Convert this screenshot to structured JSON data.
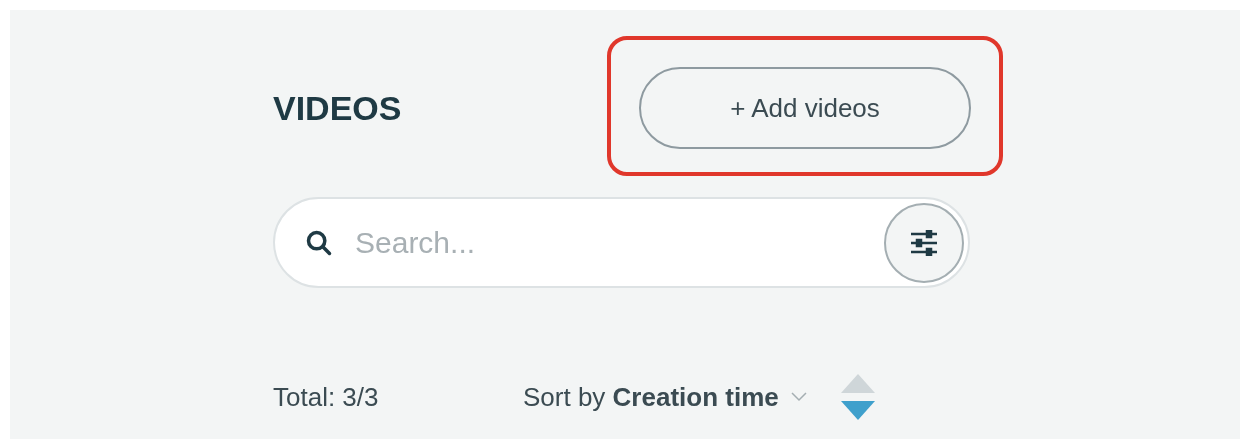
{
  "title": "VIDEOS",
  "add_button": {
    "label": "+ Add videos",
    "highlighted": true
  },
  "search": {
    "placeholder": "Search..."
  },
  "total": "Total: 3/3",
  "sort": {
    "text": "Sort by **Creation time**",
    "descending": true
  }
}
